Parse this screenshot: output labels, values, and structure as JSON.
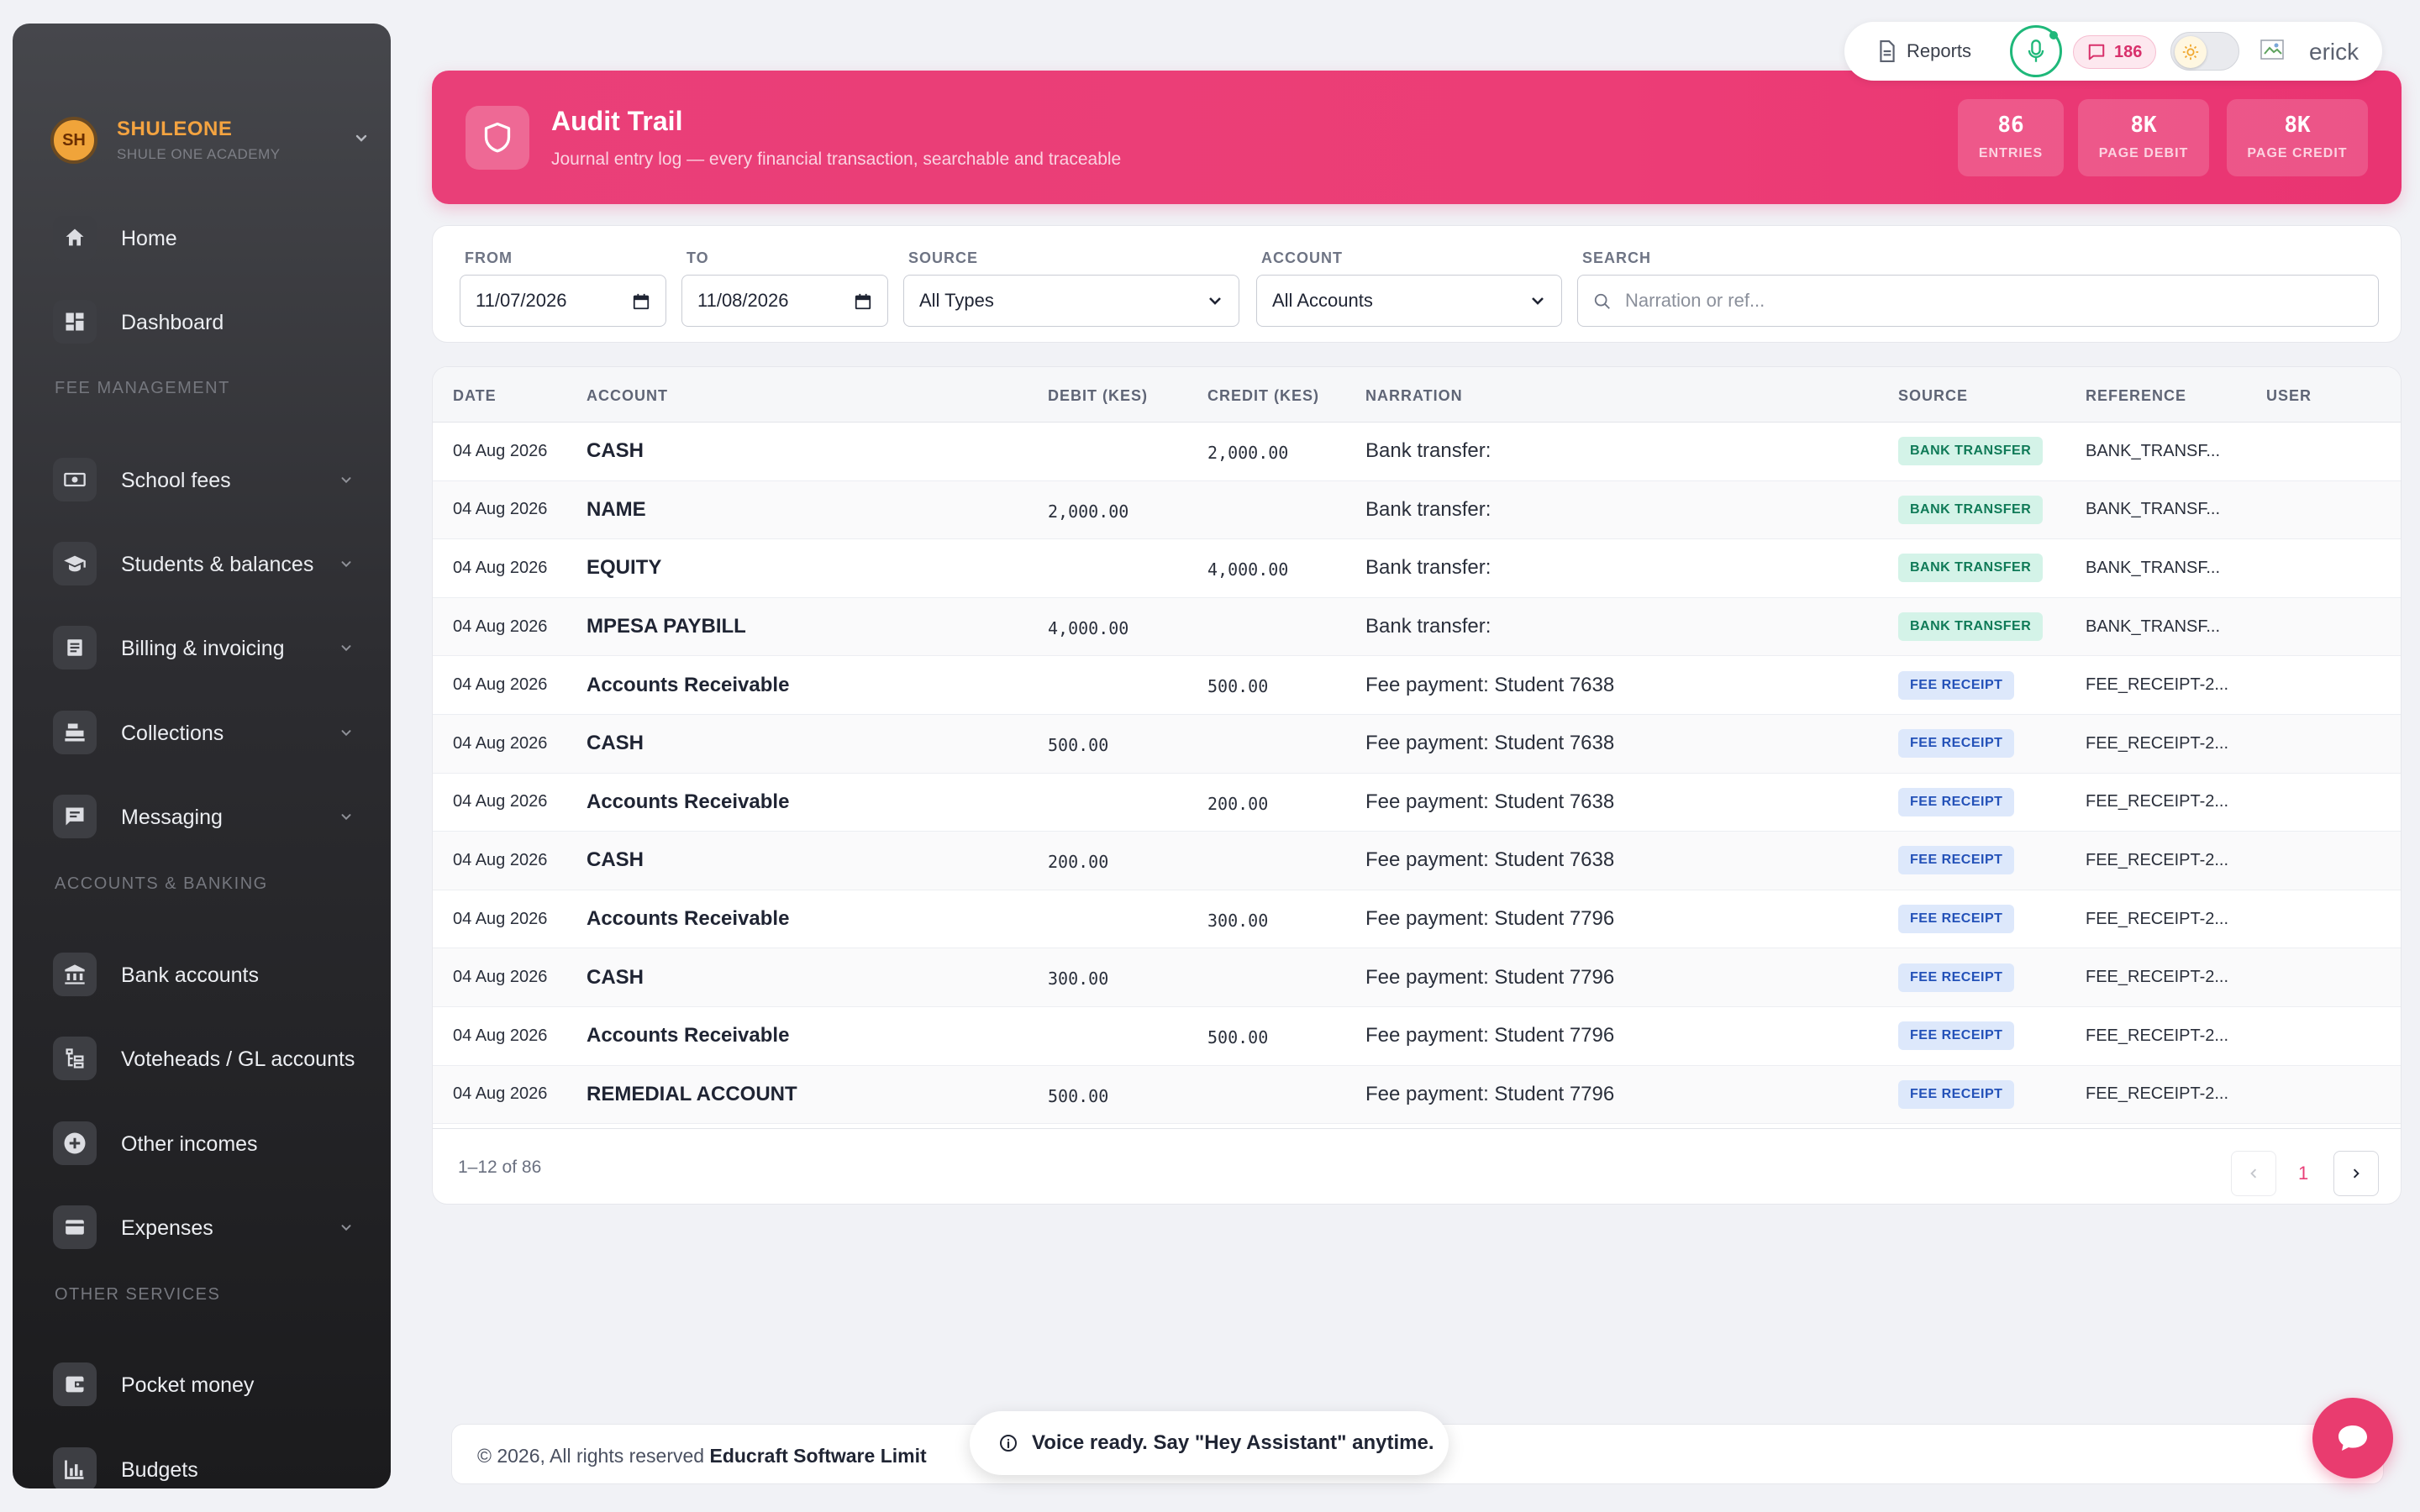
{
  "brand": {
    "initials": "SH",
    "name": "SHULEONE",
    "subtitle": "SHULE ONE ACADEMY"
  },
  "sidebar": {
    "items": [
      {
        "label": "Home",
        "icon": "home-icon"
      },
      {
        "label": "Dashboard",
        "icon": "dashboard-icon"
      },
      {
        "label": "School fees",
        "icon": "cash-icon"
      },
      {
        "label": "Students & balances",
        "icon": "graduation-cap-icon"
      },
      {
        "label": "Billing & invoicing",
        "icon": "invoice-icon"
      },
      {
        "label": "Collections",
        "icon": "cash-register-icon"
      },
      {
        "label": "Messaging",
        "icon": "message-icon"
      },
      {
        "label": "Bank accounts",
        "icon": "bank-icon"
      },
      {
        "label": "Voteheads / GL accounts",
        "icon": "tree-icon"
      },
      {
        "label": "Other incomes",
        "icon": "plus-circle-icon"
      },
      {
        "label": "Expenses",
        "icon": "credit-card-icon"
      },
      {
        "label": "Pocket money",
        "icon": "wallet-icon"
      },
      {
        "label": "Budgets",
        "icon": "bar-chart-icon"
      }
    ],
    "sections": {
      "fee": "FEE MANAGEMENT",
      "accounts": "ACCOUNTS & BANKING",
      "other": "OTHER SERVICES"
    }
  },
  "topbar": {
    "reports_label": "Reports",
    "messages_count": "186",
    "user_name": "erick"
  },
  "banner": {
    "title": "Audit Trail",
    "subtitle": "Journal entry log — every financial transaction, searchable and traceable",
    "stats": [
      {
        "value": "86",
        "label": "ENTRIES"
      },
      {
        "value": "8K",
        "label": "PAGE DEBIT"
      },
      {
        "value": "8K",
        "label": "PAGE CREDIT"
      }
    ]
  },
  "filters": {
    "from_label": "FROM",
    "from_value": "11/07/2026",
    "to_label": "TO",
    "to_value": "11/08/2026",
    "source_label": "SOURCE",
    "source_value": "All Types",
    "account_label": "ACCOUNT",
    "account_value": "All Accounts",
    "search_label": "SEARCH",
    "search_placeholder": "Narration or ref..."
  },
  "table": {
    "headers": {
      "date": "DATE",
      "account": "ACCOUNT",
      "debit": "DEBIT (KES)",
      "credit": "CREDIT (KES)",
      "narration": "NARRATION",
      "source": "SOURCE",
      "reference": "REFERENCE",
      "user": "USER"
    },
    "rows": [
      {
        "date": "04 Aug 2026",
        "account": "CASH",
        "debit": "",
        "credit": "2,000.00",
        "narration": "Bank transfer:",
        "source": "BANK TRANSFER",
        "reference": "BANK_TRANSF..."
      },
      {
        "date": "04 Aug 2026",
        "account": "NAME",
        "debit": "2,000.00",
        "credit": "",
        "narration": "Bank transfer:",
        "source": "BANK TRANSFER",
        "reference": "BANK_TRANSF..."
      },
      {
        "date": "04 Aug 2026",
        "account": "EQUITY",
        "debit": "",
        "credit": "4,000.00",
        "narration": "Bank transfer:",
        "source": "BANK TRANSFER",
        "reference": "BANK_TRANSF..."
      },
      {
        "date": "04 Aug 2026",
        "account": "MPESA PAYBILL",
        "debit": "4,000.00",
        "credit": "",
        "narration": "Bank transfer:",
        "source": "BANK TRANSFER",
        "reference": "BANK_TRANSF..."
      },
      {
        "date": "04 Aug 2026",
        "account": "Accounts Receivable",
        "debit": "",
        "credit": "500.00",
        "narration": "Fee payment: Student 7638",
        "source": "FEE RECEIPT",
        "reference": "FEE_RECEIPT-2..."
      },
      {
        "date": "04 Aug 2026",
        "account": "CASH",
        "debit": "500.00",
        "credit": "",
        "narration": "Fee payment: Student 7638",
        "source": "FEE RECEIPT",
        "reference": "FEE_RECEIPT-2..."
      },
      {
        "date": "04 Aug 2026",
        "account": "Accounts Receivable",
        "debit": "",
        "credit": "200.00",
        "narration": "Fee payment: Student 7638",
        "source": "FEE RECEIPT",
        "reference": "FEE_RECEIPT-2..."
      },
      {
        "date": "04 Aug 2026",
        "account": "CASH",
        "debit": "200.00",
        "credit": "",
        "narration": "Fee payment: Student 7638",
        "source": "FEE RECEIPT",
        "reference": "FEE_RECEIPT-2..."
      },
      {
        "date": "04 Aug 2026",
        "account": "Accounts Receivable",
        "debit": "",
        "credit": "300.00",
        "narration": "Fee payment: Student 7796",
        "source": "FEE RECEIPT",
        "reference": "FEE_RECEIPT-2..."
      },
      {
        "date": "04 Aug 2026",
        "account": "CASH",
        "debit": "300.00",
        "credit": "",
        "narration": "Fee payment: Student 7796",
        "source": "FEE RECEIPT",
        "reference": "FEE_RECEIPT-2..."
      },
      {
        "date": "04 Aug 2026",
        "account": "Accounts Receivable",
        "debit": "",
        "credit": "500.00",
        "narration": "Fee payment: Student 7796",
        "source": "FEE RECEIPT",
        "reference": "FEE_RECEIPT-2..."
      },
      {
        "date": "04 Aug 2026",
        "account": "REMEDIAL ACCOUNT",
        "debit": "500.00",
        "credit": "",
        "narration": "Fee payment: Student 7796",
        "source": "FEE RECEIPT",
        "reference": "FEE_RECEIPT-2..."
      }
    ]
  },
  "pagination": {
    "summary": "1–12 of 86",
    "current_page": "1"
  },
  "footer": {
    "text": "© 2026, All rights reserved",
    "company": "Educraft Software Limit"
  },
  "toast": {
    "message": "Voice ready. Say \"Hey Assistant\" anytime."
  },
  "colors": {
    "accent": "#e93f78",
    "sidebar": "#2c2c30",
    "bank_pill": "#d4f3e8",
    "fee_pill": "#dde8fb"
  }
}
